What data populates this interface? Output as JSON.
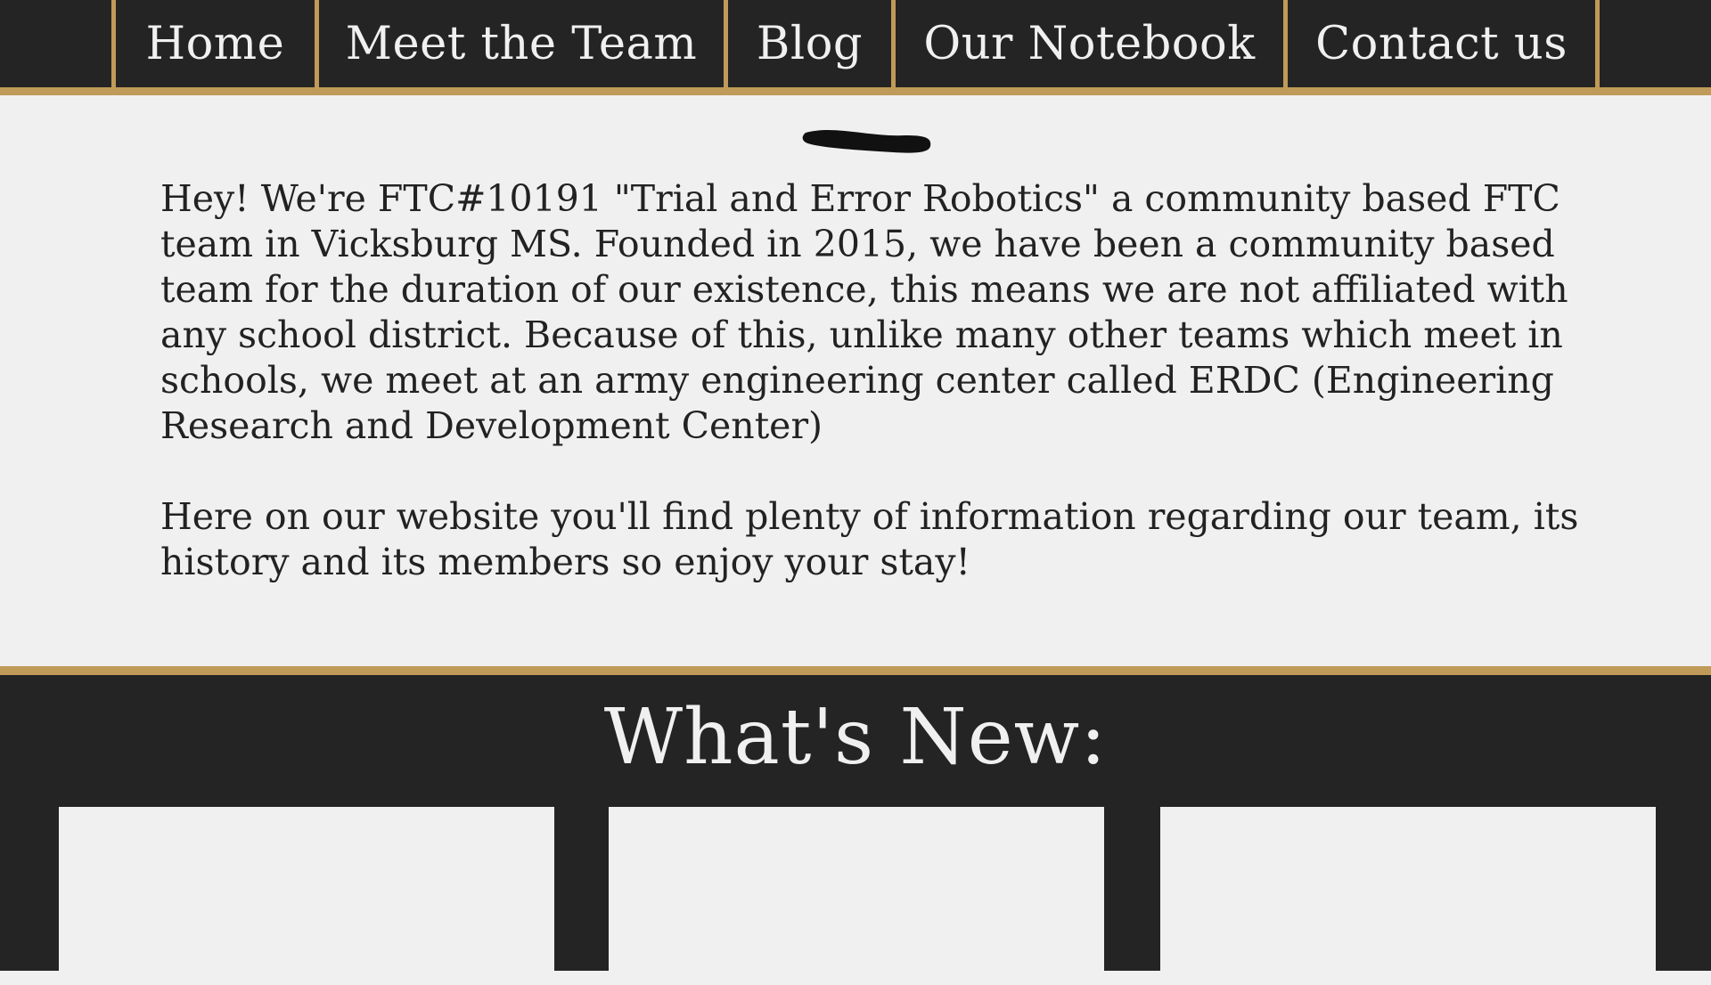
{
  "nav": {
    "items": [
      {
        "label": "Home"
      },
      {
        "label": "Meet the Team"
      },
      {
        "label": "Blog"
      },
      {
        "label": "Our Notebook"
      },
      {
        "label": "Contact us"
      }
    ]
  },
  "intro": {
    "paragraph_1": "Hey! We're FTC#10191 \"Trial and Error Robotics\" a community based FTC team in Vicksburg MS. Founded in 2015, we have been a community based team for the duration of our existence, this means we are not affiliated with any school district. Because of this, unlike many other teams which meet in schools, we meet at an army engineering center called ERDC (Engineering Research and Development Center)",
    "paragraph_2": "Here on our website you'll find plenty of information regarding our team, its history and its members so enjoy your stay!"
  },
  "news": {
    "title": "What's New:"
  },
  "colors": {
    "dark": "#242424",
    "gold": "#c09a58",
    "light": "#f0f0f0"
  }
}
